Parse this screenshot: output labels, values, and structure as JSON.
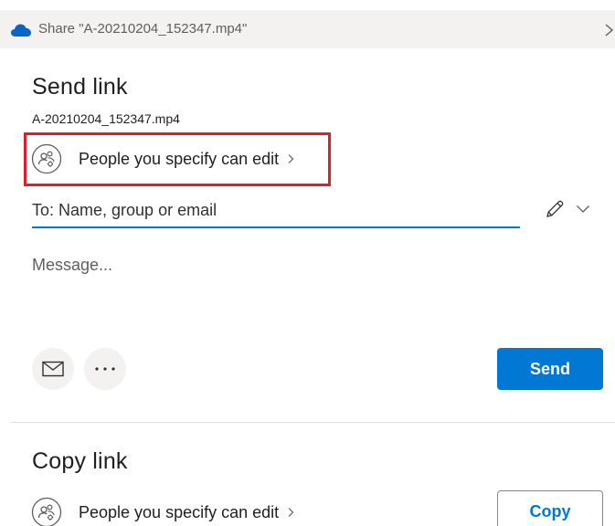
{
  "titlebar": {
    "title": "Share \"A-20210204_152347.mp4\"",
    "icon": "onedrive-cloud-icon",
    "close_icon": "close-chevron-icon"
  },
  "send_link": {
    "heading": "Send link",
    "filename": "A-20210204_152347.mp4",
    "permission_label": "People you specify can edit",
    "to_placeholder": "To: Name, group or email",
    "message_placeholder": "Message...",
    "send_label": "Send"
  },
  "copy_link": {
    "heading": "Copy link",
    "permission_label": "People you specify can edit",
    "copy_label": "Copy"
  },
  "colors": {
    "accent": "#0078d4",
    "highlight": "#e01e2b",
    "titlebar_bg": "#f3f2f1"
  }
}
